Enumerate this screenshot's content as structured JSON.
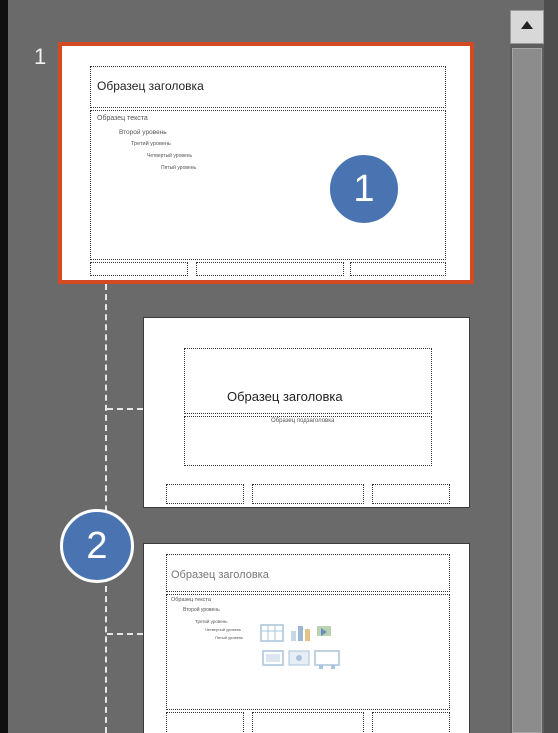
{
  "slide_number": "1",
  "master": {
    "title": "Образец заголовка",
    "bullets": [
      "Образец текста",
      "Второй уровень",
      "Третий уровень",
      "Четвертый уровень",
      "Пятый уровень"
    ]
  },
  "layout_title": {
    "title": "Образец заголовка",
    "subtitle": "Образец подзаголовка"
  },
  "layout_content": {
    "title": "Образец заголовка",
    "bullets": [
      "Образец текста",
      "Второй уровень",
      "Третий уровень",
      "Четвертый уровень",
      "Пятый уровень"
    ]
  },
  "badges": [
    "1",
    "2"
  ],
  "colors": {
    "panel_bg": "#6a6a6a",
    "selection_border": "#d34a22",
    "badge_fill": "#4a73b2"
  },
  "icons": [
    "scroll-up-arrow-icon",
    "content-placeholder-icons"
  ]
}
